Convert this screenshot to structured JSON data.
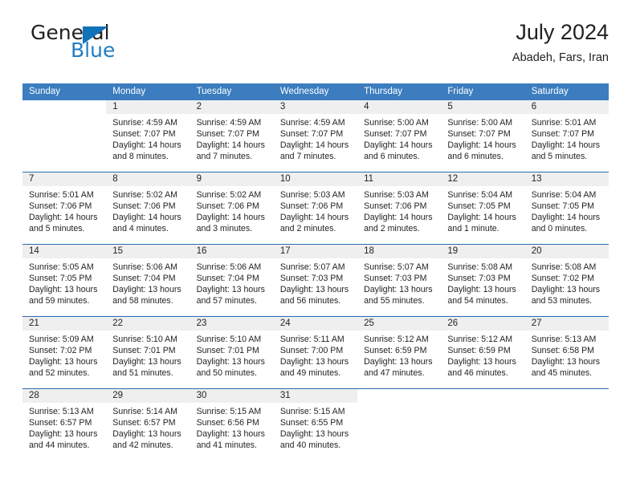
{
  "brand": {
    "name_part1": "General",
    "name_part2": "Blue",
    "accent_color": "#1272b8"
  },
  "header": {
    "title": "July 2024",
    "location": "Abadeh, Fars, Iran"
  },
  "theme": {
    "header_bg": "#3b7dbf",
    "row_divider": "#2a6aad",
    "daynum_band": "#efefef"
  },
  "weekdays": [
    "Sunday",
    "Monday",
    "Tuesday",
    "Wednesday",
    "Thursday",
    "Friday",
    "Saturday"
  ],
  "weeks": [
    [
      {
        "day": "",
        "empty": true,
        "lines": []
      },
      {
        "day": "1",
        "lines": [
          "Sunrise: 4:59 AM",
          "Sunset: 7:07 PM",
          "Daylight: 14 hours",
          "and 8 minutes."
        ]
      },
      {
        "day": "2",
        "lines": [
          "Sunrise: 4:59 AM",
          "Sunset: 7:07 PM",
          "Daylight: 14 hours",
          "and 7 minutes."
        ]
      },
      {
        "day": "3",
        "lines": [
          "Sunrise: 4:59 AM",
          "Sunset: 7:07 PM",
          "Daylight: 14 hours",
          "and 7 minutes."
        ]
      },
      {
        "day": "4",
        "lines": [
          "Sunrise: 5:00 AM",
          "Sunset: 7:07 PM",
          "Daylight: 14 hours",
          "and 6 minutes."
        ]
      },
      {
        "day": "5",
        "lines": [
          "Sunrise: 5:00 AM",
          "Sunset: 7:07 PM",
          "Daylight: 14 hours",
          "and 6 minutes."
        ]
      },
      {
        "day": "6",
        "lines": [
          "Sunrise: 5:01 AM",
          "Sunset: 7:07 PM",
          "Daylight: 14 hours",
          "and 5 minutes."
        ]
      }
    ],
    [
      {
        "day": "7",
        "lines": [
          "Sunrise: 5:01 AM",
          "Sunset: 7:06 PM",
          "Daylight: 14 hours",
          "and 5 minutes."
        ]
      },
      {
        "day": "8",
        "lines": [
          "Sunrise: 5:02 AM",
          "Sunset: 7:06 PM",
          "Daylight: 14 hours",
          "and 4 minutes."
        ]
      },
      {
        "day": "9",
        "lines": [
          "Sunrise: 5:02 AM",
          "Sunset: 7:06 PM",
          "Daylight: 14 hours",
          "and 3 minutes."
        ]
      },
      {
        "day": "10",
        "lines": [
          "Sunrise: 5:03 AM",
          "Sunset: 7:06 PM",
          "Daylight: 14 hours",
          "and 2 minutes."
        ]
      },
      {
        "day": "11",
        "lines": [
          "Sunrise: 5:03 AM",
          "Sunset: 7:06 PM",
          "Daylight: 14 hours",
          "and 2 minutes."
        ]
      },
      {
        "day": "12",
        "lines": [
          "Sunrise: 5:04 AM",
          "Sunset: 7:05 PM",
          "Daylight: 14 hours",
          "and 1 minute."
        ]
      },
      {
        "day": "13",
        "lines": [
          "Sunrise: 5:04 AM",
          "Sunset: 7:05 PM",
          "Daylight: 14 hours",
          "and 0 minutes."
        ]
      }
    ],
    [
      {
        "day": "14",
        "lines": [
          "Sunrise: 5:05 AM",
          "Sunset: 7:05 PM",
          "Daylight: 13 hours",
          "and 59 minutes."
        ]
      },
      {
        "day": "15",
        "lines": [
          "Sunrise: 5:06 AM",
          "Sunset: 7:04 PM",
          "Daylight: 13 hours",
          "and 58 minutes."
        ]
      },
      {
        "day": "16",
        "lines": [
          "Sunrise: 5:06 AM",
          "Sunset: 7:04 PM",
          "Daylight: 13 hours",
          "and 57 minutes."
        ]
      },
      {
        "day": "17",
        "lines": [
          "Sunrise: 5:07 AM",
          "Sunset: 7:03 PM",
          "Daylight: 13 hours",
          "and 56 minutes."
        ]
      },
      {
        "day": "18",
        "lines": [
          "Sunrise: 5:07 AM",
          "Sunset: 7:03 PM",
          "Daylight: 13 hours",
          "and 55 minutes."
        ]
      },
      {
        "day": "19",
        "lines": [
          "Sunrise: 5:08 AM",
          "Sunset: 7:03 PM",
          "Daylight: 13 hours",
          "and 54 minutes."
        ]
      },
      {
        "day": "20",
        "lines": [
          "Sunrise: 5:08 AM",
          "Sunset: 7:02 PM",
          "Daylight: 13 hours",
          "and 53 minutes."
        ]
      }
    ],
    [
      {
        "day": "21",
        "lines": [
          "Sunrise: 5:09 AM",
          "Sunset: 7:02 PM",
          "Daylight: 13 hours",
          "and 52 minutes."
        ]
      },
      {
        "day": "22",
        "lines": [
          "Sunrise: 5:10 AM",
          "Sunset: 7:01 PM",
          "Daylight: 13 hours",
          "and 51 minutes."
        ]
      },
      {
        "day": "23",
        "lines": [
          "Sunrise: 5:10 AM",
          "Sunset: 7:01 PM",
          "Daylight: 13 hours",
          "and 50 minutes."
        ]
      },
      {
        "day": "24",
        "lines": [
          "Sunrise: 5:11 AM",
          "Sunset: 7:00 PM",
          "Daylight: 13 hours",
          "and 49 minutes."
        ]
      },
      {
        "day": "25",
        "lines": [
          "Sunrise: 5:12 AM",
          "Sunset: 6:59 PM",
          "Daylight: 13 hours",
          "and 47 minutes."
        ]
      },
      {
        "day": "26",
        "lines": [
          "Sunrise: 5:12 AM",
          "Sunset: 6:59 PM",
          "Daylight: 13 hours",
          "and 46 minutes."
        ]
      },
      {
        "day": "27",
        "lines": [
          "Sunrise: 5:13 AM",
          "Sunset: 6:58 PM",
          "Daylight: 13 hours",
          "and 45 minutes."
        ]
      }
    ],
    [
      {
        "day": "28",
        "lines": [
          "Sunrise: 5:13 AM",
          "Sunset: 6:57 PM",
          "Daylight: 13 hours",
          "and 44 minutes."
        ]
      },
      {
        "day": "29",
        "lines": [
          "Sunrise: 5:14 AM",
          "Sunset: 6:57 PM",
          "Daylight: 13 hours",
          "and 42 minutes."
        ]
      },
      {
        "day": "30",
        "lines": [
          "Sunrise: 5:15 AM",
          "Sunset: 6:56 PM",
          "Daylight: 13 hours",
          "and 41 minutes."
        ]
      },
      {
        "day": "31",
        "lines": [
          "Sunrise: 5:15 AM",
          "Sunset: 6:55 PM",
          "Daylight: 13 hours",
          "and 40 minutes."
        ]
      },
      {
        "day": "",
        "empty": true,
        "lines": []
      },
      {
        "day": "",
        "empty": true,
        "lines": []
      },
      {
        "day": "",
        "empty": true,
        "lines": []
      }
    ]
  ]
}
